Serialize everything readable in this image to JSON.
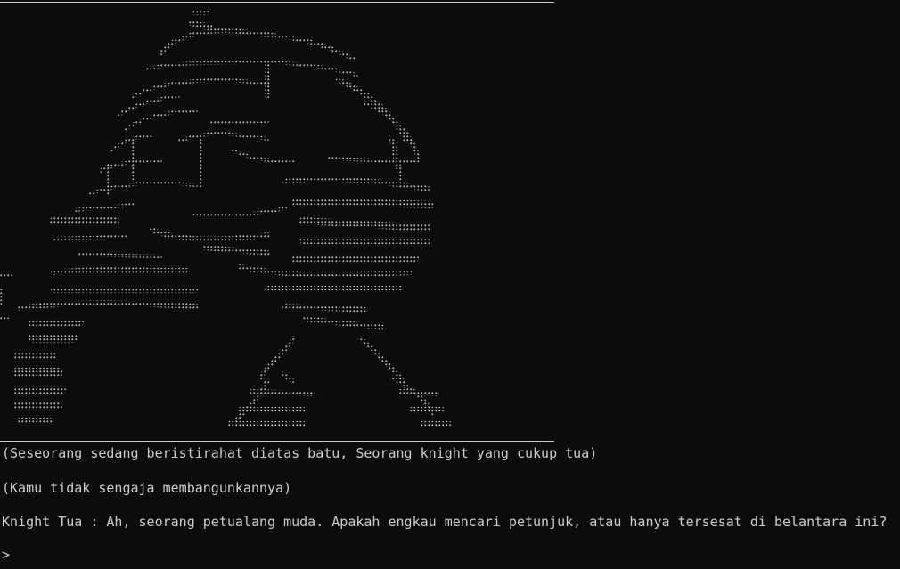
{
  "terminal": {
    "narration_1": "(Seseorang sedang beristirahat diatas batu, Seorang knight yang cukup tua)",
    "narration_2": "(Kamu tidak sengaja membangunkannya)",
    "dialogue": "Knight Tua : Ah, seorang petualang muda. Apakah engkau mencari petunjuk, atau hanya tersesat di belantara ini?",
    "prompt": ">",
    "input_value": ""
  },
  "art": {
    "subject": "old knight resting on a rock (braille ascii art)",
    "color": "#cccccc"
  },
  "colors": {
    "background": "#0c0c0c",
    "foreground": "#cccccc"
  }
}
